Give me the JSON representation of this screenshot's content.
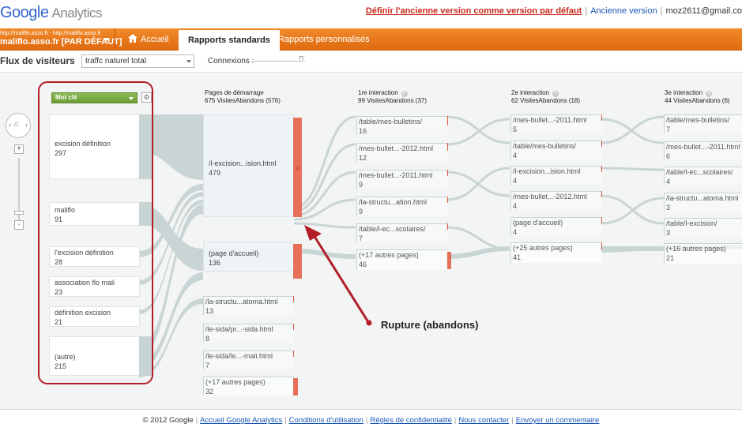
{
  "header": {
    "logo_google": "Google",
    "logo_product": "Analytics",
    "set_default_link": "Définir l'ancienne version comme version par défaut",
    "old_version_link": "Ancienne version",
    "user_email": "moz2611@gmail.co"
  },
  "nav": {
    "account_urls": "http://maliflo.asso.fr - http://maliflo.asso.fr",
    "account_name": "maliflo.asso.fr [PAR DÉFAUT]",
    "home": "Accueil",
    "standard_reports": "Rapports standards",
    "custom_reports": "Rapports personnalisés"
  },
  "toolbar": {
    "title": "Flux de visiteurs",
    "segment_value": "traffc naturel total",
    "connections_label": "Connexions :"
  },
  "columns": {
    "dimension_button": "Mot clé",
    "start_header": "Pages de démarrage",
    "start_stats": "675 VisitesAbandons (576)",
    "i1_header": "1re interaction",
    "i1_stats": "99 VisitesAbandons (37)",
    "i2_header": "2e interaction",
    "i2_stats": "62 VisitesAbandons (18)",
    "i3_header": "3e interaction",
    "i3_stats": "44 VisitesAbandons (6)"
  },
  "keywords": [
    {
      "label": "excision définition",
      "value": "297"
    },
    {
      "label": "maliflo",
      "value": "91"
    },
    {
      "label": "l'excision définition",
      "value": "28"
    },
    {
      "label": "association flo mali",
      "value": "23"
    },
    {
      "label": "définition excision",
      "value": "21"
    },
    {
      "label": "(autre)",
      "value": "215"
    }
  ],
  "start_pages": [
    {
      "label": "/l-excision...ision.html",
      "value": "479"
    },
    {
      "label": "(page d'accueil)",
      "value": "136"
    },
    {
      "label": "/la-structu...atoma.html",
      "value": "13"
    },
    {
      "label": "/le-sida/pr...-sida.html",
      "value": "8"
    },
    {
      "label": "/le-sida/le...-mali.html",
      "value": "7"
    },
    {
      "label": "(+17 autres pages)",
      "value": "32"
    }
  ],
  "interaction1": [
    {
      "label": "/table/mes-bulletins/",
      "value": "16"
    },
    {
      "label": "/mes-bullet...-2012.html",
      "value": "12"
    },
    {
      "label": "/mes-bullet...-2011.html",
      "value": "9"
    },
    {
      "label": "/la-structu...ation.html",
      "value": "9"
    },
    {
      "label": "/table/l-ec...scolaires/",
      "value": "7"
    },
    {
      "label": "(+17 autres pages)",
      "value": "46"
    }
  ],
  "interaction2": [
    {
      "label": "/mes-bullet...-2011.html",
      "value": "5"
    },
    {
      "label": "/table/mes-bulletins/",
      "value": "4"
    },
    {
      "label": "/l-excision...ision.html",
      "value": "4"
    },
    {
      "label": "/mes-bullet...-2012.html",
      "value": "4"
    },
    {
      "label": "(page d'accueil)",
      "value": "4"
    },
    {
      "label": "(+25 autres pages)",
      "value": "41"
    }
  ],
  "interaction3": [
    {
      "label": "/table/mes-bulletins/",
      "value": "7"
    },
    {
      "label": "/mes-bullet...-2011.html",
      "value": "6"
    },
    {
      "label": "/table/l-ec...scolaires/",
      "value": "4"
    },
    {
      "label": "/la-structu...atoma.html",
      "value": "3"
    },
    {
      "label": "/table/l-excision/",
      "value": "3"
    },
    {
      "label": "(+16 autres pages)",
      "value": "21"
    }
  ],
  "annotation": "Rupture (abandons)",
  "footer": {
    "copyright": "© 2012 Google",
    "links": [
      "Accueil Google Analytics",
      "Conditions d'utilisation",
      "Règles de confidentialité",
      "Nous contacter",
      "Envoyer un commentaire"
    ]
  },
  "colors": {
    "orange_nav": "#e8781c",
    "dropoff_red": "#e8705a",
    "highlight_red": "#b21d28",
    "keyword_green": "#7aa845"
  }
}
